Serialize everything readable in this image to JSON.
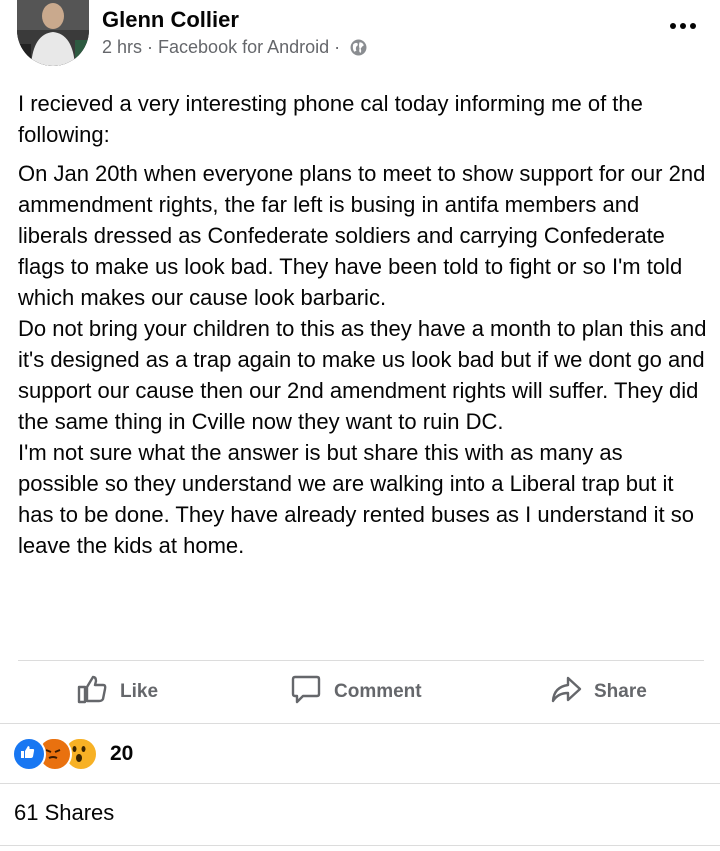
{
  "post": {
    "author": "Glenn Collier",
    "time": "2 hrs",
    "source": "Facebook for Android",
    "separator": "·",
    "privacy_icon": "globe-icon",
    "more_icon": "more-options-icon",
    "paragraphs": [
      "I recieved a very interesting phone cal today informing me of the following:",
      "On Jan 20th when everyone plans to meet to show support for our 2nd ammendment rights, the far left is busing in antifa members and liberals dressed as Confederate soldiers and carrying Confederate flags to make us look bad. They have been told to fight or so I'm told which makes our cause look barbaric.",
      "Do not bring your children to this as they have a month to plan this and it's designed as a trap again to make us look bad but if we dont go and support our cause then our 2nd amendment rights will suffer. They did the same thing in Cville now they want to ruin DC.",
      "I'm not sure what the answer is but share this with as many as possible so they understand we are walking into a Liberal trap but it has to be done. They have already rented buses as I understand it so leave the kids at home."
    ]
  },
  "actions": {
    "like": "Like",
    "comment": "Comment",
    "share": "Share"
  },
  "reactions": {
    "icons": [
      "like-reaction-icon",
      "angry-reaction-icon",
      "wow-reaction-icon"
    ],
    "count": "20"
  },
  "shares": "61 Shares",
  "colors": {
    "text": "#050505",
    "secondary": "#65676b",
    "like_blue": "#1877f2",
    "angry_orange": "#e9710f",
    "wow_yellow": "#f7b125",
    "divider": "#dcdcdc"
  }
}
